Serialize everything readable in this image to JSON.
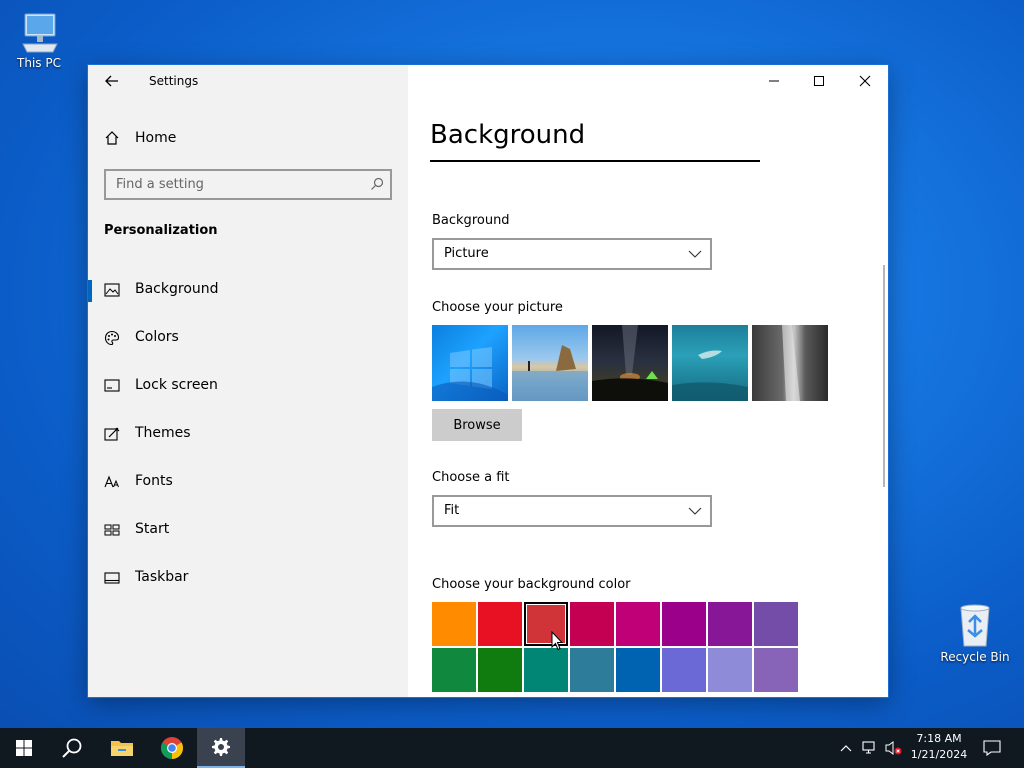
{
  "desktop": {
    "icons": [
      {
        "label": "This PC"
      },
      {
        "label": "Recycle Bin"
      }
    ]
  },
  "window": {
    "app_title": "Settings",
    "controls": {
      "minimize": "minimize",
      "maximize": "maximize",
      "close": "close"
    }
  },
  "sidebar": {
    "home_label": "Home",
    "search_placeholder": "Find a setting",
    "section_title": "Personalization",
    "items": [
      {
        "label": "Background",
        "icon": "picture-icon",
        "active": true
      },
      {
        "label": "Colors",
        "icon": "palette-icon"
      },
      {
        "label": "Lock screen",
        "icon": "lock-screen-icon"
      },
      {
        "label": "Themes",
        "icon": "themes-icon"
      },
      {
        "label": "Fonts",
        "icon": "fonts-icon"
      },
      {
        "label": "Start",
        "icon": "start-icon"
      },
      {
        "label": "Taskbar",
        "icon": "taskbar-icon"
      }
    ]
  },
  "main": {
    "page_title": "Background",
    "background_label": "Background",
    "background_value": "Picture",
    "choose_picture_label": "Choose your picture",
    "browse_label": "Browse",
    "fit_label": "Choose a fit",
    "fit_value": "Fit",
    "color_label": "Choose your background color",
    "colors_row1": [
      "#ff8c00",
      "#e81123",
      "#d13438",
      "#c30052",
      "#bf0077",
      "#9a0089",
      "#881798",
      "#744da9"
    ],
    "colors_row2": [
      "#10893e",
      "#107c10",
      "#018574",
      "#2d7d9a",
      "#0063b1",
      "#6b69d6",
      "#8e8cd8",
      "#8764b8"
    ],
    "selected_color": "#d13438"
  },
  "taskbar": {
    "time": "7:18 AM",
    "date": "1/21/2024"
  }
}
